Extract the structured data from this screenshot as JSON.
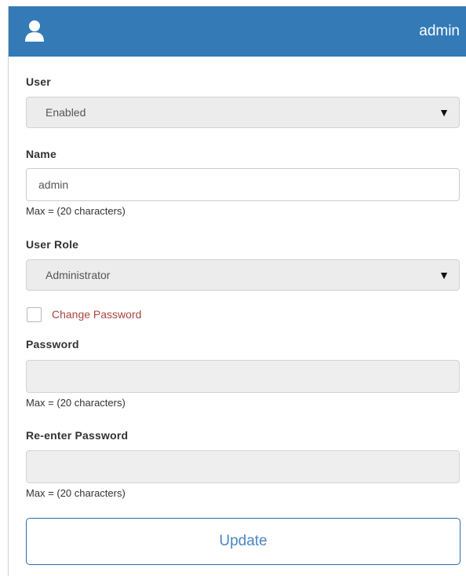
{
  "header": {
    "title": "admin",
    "icon": "user-icon",
    "color": "#337ab7"
  },
  "form": {
    "user": {
      "label": "User",
      "selected": "Enabled"
    },
    "name": {
      "label": "Name",
      "value": "admin",
      "hint": "Max = (20 characters)"
    },
    "user_role": {
      "label": "User Role",
      "selected": "Administrator"
    },
    "change_password": {
      "label": "Change Password",
      "checked": false
    },
    "password": {
      "label": "Password",
      "value": "",
      "hint": "Max = (20 characters)"
    },
    "reenter_password": {
      "label": "Re-enter Password",
      "value": "",
      "hint": "Max = (20 characters)"
    },
    "dropdown_arrow": "▼",
    "submit_label": "Update"
  }
}
